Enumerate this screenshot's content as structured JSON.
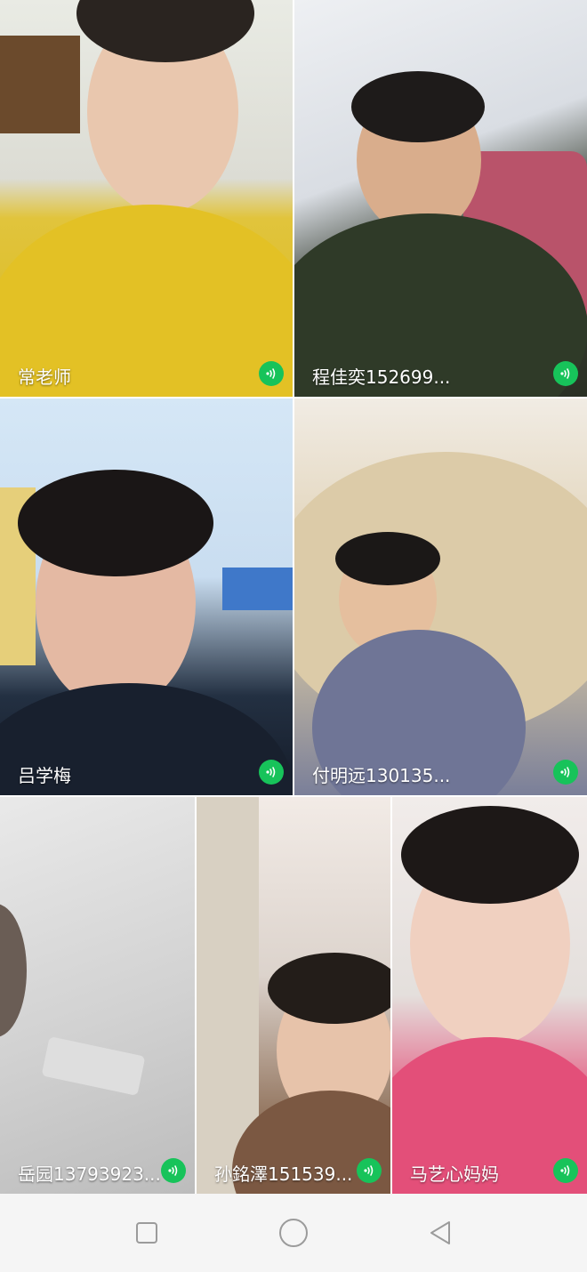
{
  "participants": [
    {
      "name": "常老师",
      "speaking": true
    },
    {
      "name": "程佳奕152699...",
      "speaking": true
    },
    {
      "name": "吕学梅",
      "speaking": true
    },
    {
      "name": "付明远130135...",
      "speaking": true
    },
    {
      "name": "岳园13793923...",
      "speaking": true
    },
    {
      "name": "孙銘澤151539...",
      "speaking": true
    },
    {
      "name": "马艺心妈妈",
      "speaking": true
    }
  ],
  "colors": {
    "speaking_indicator": "#17c35a",
    "nav_icon": "#9b9b9b",
    "nav_background": "#f5f5f5"
  },
  "nav": {
    "recent_icon": "square-icon",
    "home_icon": "circle-icon",
    "back_icon": "triangle-back-icon"
  }
}
